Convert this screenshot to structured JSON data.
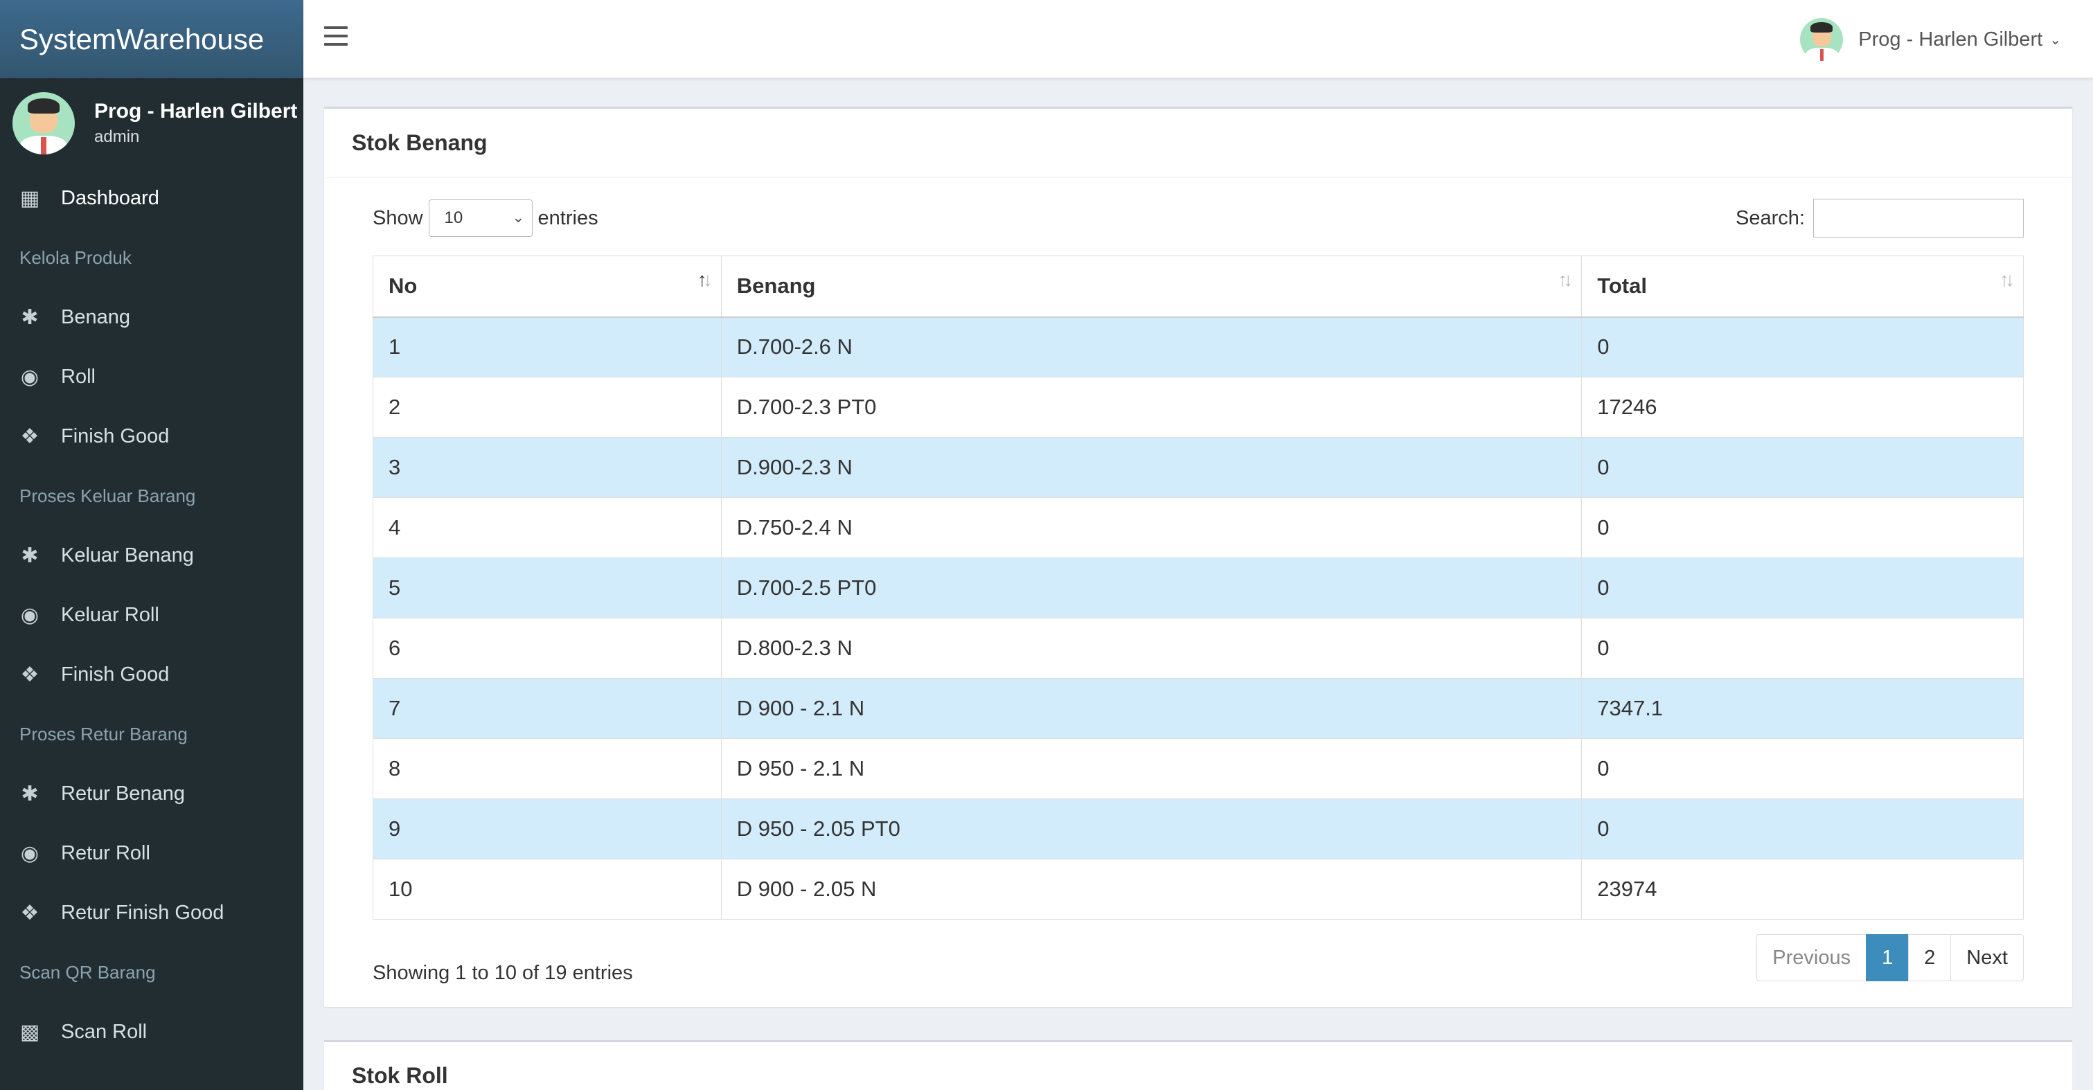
{
  "brand": "SystemWarehouse",
  "user": {
    "name": "Prog - Harlen Gilbert",
    "role": "admin"
  },
  "sidebar": {
    "items": [
      {
        "type": "item",
        "label": "Dashboard",
        "icon": "dashboard-icon"
      },
      {
        "type": "header",
        "label": "Kelola Produk"
      },
      {
        "type": "item",
        "label": "Benang",
        "icon": "asterisk-icon"
      },
      {
        "type": "item",
        "label": "Roll",
        "icon": "circle-dot-icon"
      },
      {
        "type": "item",
        "label": "Finish Good",
        "icon": "puzzle-icon"
      },
      {
        "type": "header",
        "label": "Proses Keluar Barang"
      },
      {
        "type": "item",
        "label": "Keluar Benang",
        "icon": "asterisk-icon"
      },
      {
        "type": "item",
        "label": "Keluar Roll",
        "icon": "circle-dot-icon"
      },
      {
        "type": "item",
        "label": "Finish Good",
        "icon": "puzzle-icon"
      },
      {
        "type": "header",
        "label": "Proses Retur Barang"
      },
      {
        "type": "item",
        "label": "Retur Benang",
        "icon": "asterisk-icon"
      },
      {
        "type": "item",
        "label": "Retur Roll",
        "icon": "circle-dot-icon"
      },
      {
        "type": "item",
        "label": "Retur Finish Good",
        "icon": "puzzle-icon"
      },
      {
        "type": "header",
        "label": "Scan QR Barang"
      },
      {
        "type": "item",
        "label": "Scan Roll",
        "icon": "qr-code-icon"
      }
    ]
  },
  "topbar": {
    "user_label": "Prog - Harlen Gilbert"
  },
  "box1": {
    "title": "Stok Benang",
    "show_label": "Show",
    "length_value": "10",
    "entries_label": "entries",
    "search_label": "Search:",
    "columns": [
      "No",
      "Benang",
      "Total"
    ],
    "rows": [
      [
        "1",
        "D.700-2.6 N",
        "0"
      ],
      [
        "2",
        "D.700-2.3 PT0",
        "17246"
      ],
      [
        "3",
        "D.900-2.3 N",
        "0"
      ],
      [
        "4",
        "D.750-2.4 N",
        "0"
      ],
      [
        "5",
        "D.700-2.5 PT0",
        "0"
      ],
      [
        "6",
        "D.800-2.3 N",
        "0"
      ],
      [
        "7",
        "D 900 - 2.1 N",
        "7347.1"
      ],
      [
        "8",
        "D 950 - 2.1 N",
        "0"
      ],
      [
        "9",
        "D 950 - 2.05 PT0",
        "0"
      ],
      [
        "10",
        "D 900 - 2.05 N",
        "23974"
      ]
    ],
    "info": "Showing 1 to 10 of 19 entries",
    "pager": {
      "previous": "Previous",
      "pages": [
        "1",
        "2"
      ],
      "next": "Next"
    }
  },
  "box2": {
    "title": "Stok Roll"
  }
}
